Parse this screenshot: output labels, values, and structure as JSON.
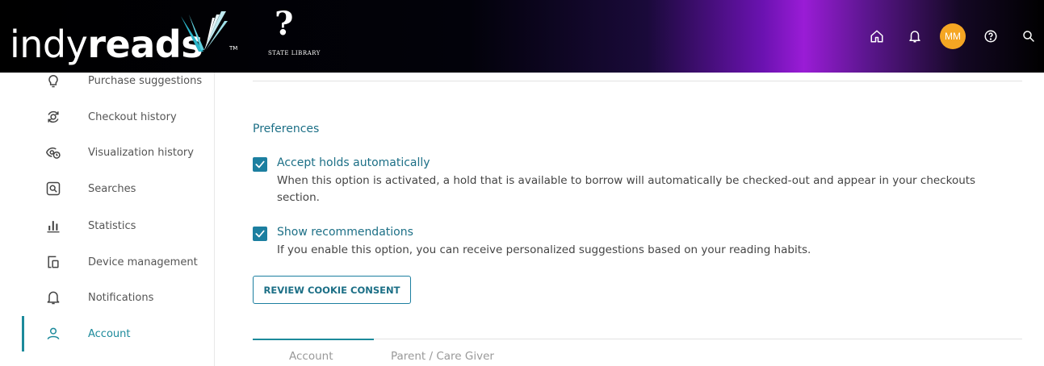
{
  "header": {
    "logo_light": "indy",
    "logo_bold": "reads",
    "logo_tm": "TM",
    "partner_mark": "?",
    "partner_name": "STATE LIBRARY",
    "avatar_initials": "MM",
    "icons": [
      "home-icon",
      "bell-icon",
      "help-icon",
      "search-icon"
    ]
  },
  "sidebar": {
    "items": [
      {
        "label": "Purchase suggestions",
        "icon": "lightbulb-icon"
      },
      {
        "label": "Checkout history",
        "icon": "checkout-history-icon"
      },
      {
        "label": "Visualization history",
        "icon": "visualization-history-icon"
      },
      {
        "label": "Searches",
        "icon": "search-box-icon"
      },
      {
        "label": "Statistics",
        "icon": "bar-chart-icon"
      },
      {
        "label": "Device management",
        "icon": "devices-icon"
      },
      {
        "label": "Notifications",
        "icon": "bell-icon"
      },
      {
        "label": "Account",
        "icon": "user-icon",
        "active": true
      }
    ]
  },
  "main": {
    "section_title": "Preferences",
    "preferences": [
      {
        "title": "Accept holds automatically",
        "description": "When this option is activated, a hold that is available to borrow will automatically be checked-out and appear in your checkouts section.",
        "checked": true
      },
      {
        "title": "Show recommendations",
        "description": "If you enable this option, you can receive personalized suggestions based on your reading habits.",
        "checked": true
      }
    ],
    "cookie_button": "REVIEW COOKIE CONSENT",
    "tabs": [
      {
        "label": "Account",
        "active": true
      },
      {
        "label": "Parent / Care Giver",
        "active": false
      }
    ]
  },
  "colors": {
    "accent": "#1c8a9b",
    "checkbox": "#1c7fa0",
    "avatar": "#f5a623",
    "header_glow": "#9a1cd6"
  }
}
